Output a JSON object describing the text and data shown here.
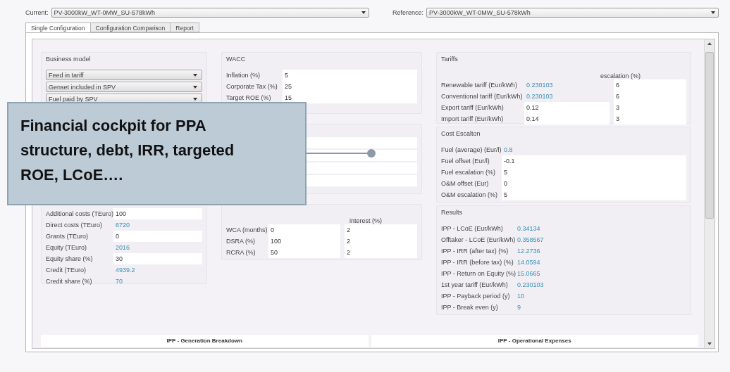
{
  "current": {
    "label": "Current:",
    "value": "PV-3000kW_WT-0MW_SU-578kWh"
  },
  "reference": {
    "label": "Reference:",
    "value": "PV-3000kW_WT-0MW_SU-578kWh"
  },
  "tabs": [
    {
      "label": "Single Configuration",
      "selected": true
    },
    {
      "label": "Configuration Comparison",
      "selected": false
    },
    {
      "label": "Report",
      "selected": false
    }
  ],
  "business_model": {
    "title": "Business model",
    "dropdowns": [
      "Feed in tariff",
      "Genset included in SPV",
      "Fuel paid by SPV"
    ],
    "fields": [
      {
        "label": "Additional costs (TEuro)",
        "value": "100",
        "computed": false
      },
      {
        "label": "Direct costs (TEuro)",
        "value": "6720",
        "computed": true
      },
      {
        "label": "Grants (TEuro)",
        "value": "0",
        "computed": false
      },
      {
        "label": "Equity (TEuro)",
        "value": "2016",
        "computed": true
      },
      {
        "label": "Equity share (%)",
        "value": "30",
        "computed": false
      },
      {
        "label": "Credit (TEuro)",
        "value": "4939.2",
        "computed": true
      },
      {
        "label": "Credit share (%)",
        "value": "70",
        "computed": true
      }
    ]
  },
  "wacc": {
    "title": "WACC",
    "fields": [
      {
        "label": "Inflation (%)",
        "value": "5",
        "computed": false
      },
      {
        "label": "Corporate Tax (%)",
        "value": "25",
        "computed": false
      },
      {
        "label": "Target ROE (%)",
        "value": "15",
        "computed": false
      }
    ]
  },
  "reserve_accounts": {
    "column_header": "interest (%)",
    "fields": [
      {
        "label": "WCA (months)",
        "value": "0",
        "interest": "2"
      },
      {
        "label": "DSRA (%)",
        "value": "100",
        "interest": "2"
      },
      {
        "label": "RCRA (%)",
        "value": "50",
        "interest": "2"
      }
    ]
  },
  "tariffs": {
    "title": "Tariffs",
    "column_header": "escalation (%)",
    "fields": [
      {
        "label": "Renewable tariff (Eur/kWh)",
        "value": "0.230103",
        "escalation": "6",
        "computed": true
      },
      {
        "label": "Conventional tariff (Eur/kWh)",
        "value": "0.230103",
        "escalation": "6",
        "computed": true
      },
      {
        "label": "Export tariff (Eur/kWh)",
        "value": "0.12",
        "escalation": "3",
        "computed": false
      },
      {
        "label": "Import tariff (Eur/kWh)",
        "value": "0.14",
        "escalation": "3",
        "computed": false
      }
    ]
  },
  "cost_escalation": {
    "title": "Cost Escalton",
    "fields": [
      {
        "label": "Fuel (average) (Eur/l)",
        "value": "0.8",
        "computed": true
      },
      {
        "label": "Fuel offset (Eur/l)",
        "value": "-0.1",
        "computed": false
      },
      {
        "label": "Fuel escalation (%)",
        "value": "5",
        "computed": false
      },
      {
        "label": "O&M offset (Eur)",
        "value": "0",
        "computed": false
      },
      {
        "label": "O&M escalation (%)",
        "value": "5",
        "computed": false
      }
    ]
  },
  "results": {
    "title": "Results",
    "fields": [
      {
        "label": "IPP - LCoE (Eur/kWh)",
        "value": "0.34134",
        "computed": true
      },
      {
        "label": "Offtaker - LCoE (Eur/kWh)",
        "value": "0.358567",
        "computed": true
      },
      {
        "label": "IPP - IRR (after tax) (%)",
        "value": "12.2736",
        "computed": true
      },
      {
        "label": "IPP - IRR (before tax) (%)",
        "value": "14.0594",
        "computed": true
      },
      {
        "label": "IPP - Return on Equity (%)",
        "value": "15.0665",
        "computed": true
      },
      {
        "label": "1st year tariff (Eur/kWh)",
        "value": "0.230103",
        "computed": true
      },
      {
        "label": "IPP - Payback period (y)",
        "value": "10",
        "computed": true
      },
      {
        "label": "IPP - Break even (y)",
        "value": "9",
        "computed": true
      }
    ]
  },
  "charts": [
    "IPP - Generation Breakdown",
    "IPP - Operational Expenses"
  ],
  "callout": {
    "text": "Financial cockpit for PPA structure, debt, IRR, targeted ROE, LCoE…."
  }
}
